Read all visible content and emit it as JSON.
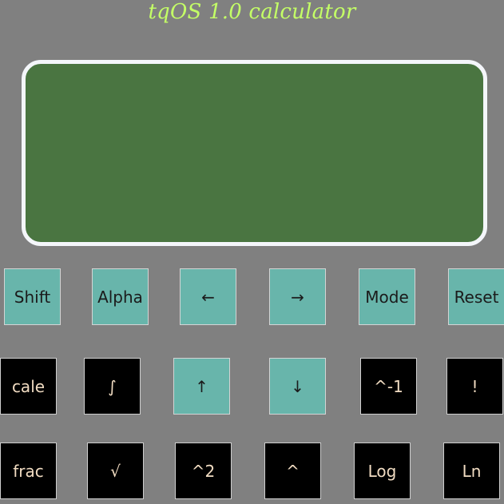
{
  "app": {
    "title": "tqOS 1.0 calculator"
  },
  "display": {
    "text": ""
  },
  "keypad": {
    "row1": [
      "Shift",
      "Alpha",
      "←",
      "→",
      "Mode",
      "Reset"
    ],
    "row2": [
      "cale",
      "∫",
      "↑",
      "↓",
      "^-1",
      "!"
    ],
    "row3": [
      "frac",
      "√",
      "^2",
      "^",
      "Log",
      "Ln"
    ]
  },
  "colors": {
    "background": "#808080",
    "title": "#c4ff66",
    "screen": "#4a7541",
    "screen_border": "#f4f6fa",
    "key_teal": "#68b5ab",
    "key_dark": "#000000",
    "key_dark_text": "#f1dcc2"
  }
}
